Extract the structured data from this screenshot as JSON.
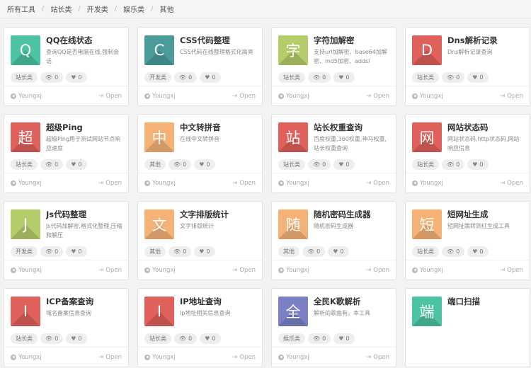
{
  "breadcrumb": [
    "所有工具",
    "站长类",
    "开发类",
    "娱乐类",
    "其他"
  ],
  "cards": [
    {
      "glyph": "Q",
      "color": "#4cc3a2",
      "title": "QQ在线状态",
      "desc": "查询QQ是否电脑在线,强制会话",
      "category": "站长类",
      "views": "0",
      "likes": "0",
      "author": "Youngxj",
      "open": "Open"
    },
    {
      "glyph": "C",
      "color": "#4b9b9b",
      "title": "CSS代码整理",
      "desc": "CSS代码在线整理格式化高亮",
      "category": "开发类",
      "views": "0",
      "likes": "0",
      "author": "Youngxj",
      "open": "Open"
    },
    {
      "glyph": "字",
      "color": "#b5cc6a",
      "title": "字符加解密",
      "desc": "支持url加解密、base64加解密、md5加密、addsl",
      "category": "站长类",
      "views": "0",
      "likes": "0",
      "author": "Youngxj",
      "open": "Open"
    },
    {
      "glyph": "D",
      "color": "#e0605b",
      "title": "Dns解析记录",
      "desc": "Dns解析记录查询",
      "category": "站长类",
      "views": "0",
      "likes": "0",
      "author": "Youngxj",
      "open": "Open"
    },
    {
      "glyph": "超",
      "color": "#e0605b",
      "title": "超级Ping",
      "desc": "超级Ping用于测试网站节点响应速度",
      "category": "站长类",
      "views": "0",
      "likes": "0",
      "author": "Youngxj",
      "open": "Open"
    },
    {
      "glyph": "中",
      "color": "#f5b277",
      "title": "中文转拼音",
      "desc": "在线中文转拼音",
      "category": "其他",
      "views": "0",
      "likes": "0",
      "author": "Youngxj",
      "open": "Open"
    },
    {
      "glyph": "站",
      "color": "#e0605b",
      "title": "站长权重查询",
      "desc": "百度权重,360权重,神马权重,站长权重查询",
      "category": "站长类",
      "views": "0",
      "likes": "0",
      "author": "Youngxj",
      "open": "Open"
    },
    {
      "glyph": "网",
      "color": "#e0605b",
      "title": "网站状态码",
      "desc": "网站状态码,http状态码,网站响应信息",
      "category": "站长类",
      "views": "0",
      "likes": "0",
      "author": "Youngxj",
      "open": "Open"
    },
    {
      "glyph": "J",
      "color": "#b5cc6a",
      "title": "Js代码整理",
      "desc": "Js代码加解密,格式化整理,压缩和解压",
      "category": "开发类",
      "views": "0",
      "likes": "0",
      "author": "Youngxj",
      "open": "Open"
    },
    {
      "glyph": "文",
      "color": "#f5b277",
      "title": "文字排版统计",
      "desc": "文字排版统计",
      "category": "其他",
      "views": "0",
      "likes": "0",
      "author": "Youngxj",
      "open": "Open"
    },
    {
      "glyph": "随",
      "color": "#f5b277",
      "title": "随机密码生成器",
      "desc": "随机密码生成器",
      "category": "其他",
      "views": "0",
      "likes": "0",
      "author": "Youngxj",
      "open": "Open"
    },
    {
      "glyph": "短",
      "color": "#f5b277",
      "title": "短网址生成",
      "desc": "短网址跳转到红生成工具",
      "category": "站长类",
      "views": "0",
      "likes": "0",
      "author": "Youngxj",
      "open": "Open"
    },
    {
      "glyph": "I",
      "color": "#e0605b",
      "title": "ICP备案查询",
      "desc": "域名备案信息查询",
      "category": "站长类",
      "views": "0",
      "likes": "0",
      "author": "Youngxj",
      "open": "Open"
    },
    {
      "glyph": "I",
      "color": "#e0605b",
      "title": "IP地址查询",
      "desc": "Ip地址相关信息查询",
      "category": "站长类",
      "views": "0",
      "likes": "0",
      "author": "Youngxj",
      "open": "Open"
    },
    {
      "glyph": "全",
      "color": "#7b7fc4",
      "title": "全民K歌解析",
      "desc": "解析的歌曲有。本工具",
      "category": "娱乐类",
      "views": "0",
      "likes": "0",
      "author": "Youngxj",
      "open": "Open"
    },
    {
      "glyph": "端",
      "color": "#4cc3a2",
      "title": "端口扫描",
      "desc": "",
      "category": "",
      "views": "",
      "likes": "",
      "author": "",
      "open": ""
    }
  ]
}
